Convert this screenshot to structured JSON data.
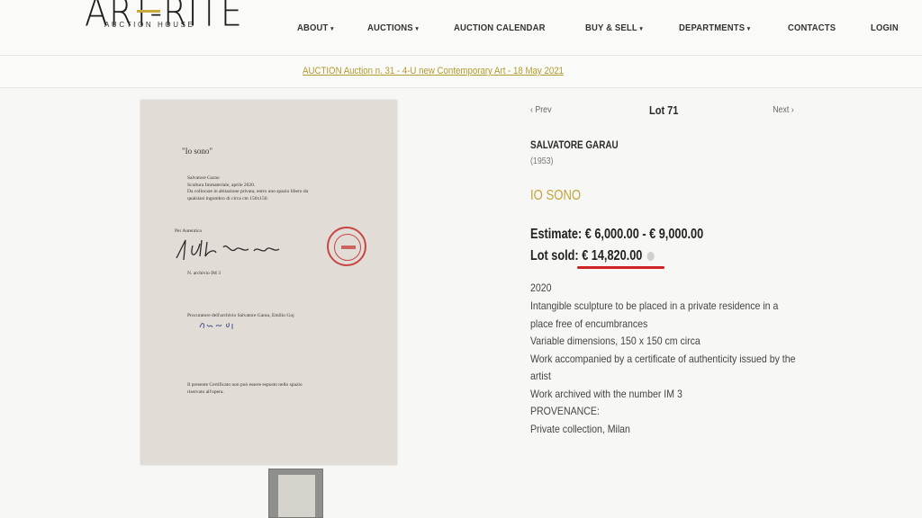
{
  "header": {
    "logo_main": "ART-RITE",
    "logo_sub": "AUCTION HOUSE",
    "nav": [
      {
        "label": "ABOUT",
        "dropdown": true
      },
      {
        "label": "AUCTIONS",
        "dropdown": true
      },
      {
        "label": "AUCTION CALENDAR",
        "dropdown": false
      },
      {
        "label": "BUY & SELL",
        "dropdown": true
      },
      {
        "label": "DEPARTMENTS",
        "dropdown": true
      },
      {
        "label": "CONTACTS",
        "dropdown": false
      },
      {
        "label": "LOGIN",
        "dropdown": false
      }
    ],
    "caret": "▾"
  },
  "auction_bar": {
    "link": "AUCTION Auction n. 31 - 4-U new Contemporary Art - 18 May 2021"
  },
  "certificate": {
    "title": "\"Io sono\"",
    "body": "Salvatore Garau\nScultura Immateriale, aprile 2020.\nDa collocare in abitazione privata, entro uno spazio libero da\nqualsiasi ingombro di circa cm 150x150.",
    "autentica": "Per Autentica",
    "archivio": "N. archivio IM 3",
    "procuratore": "Procuratore dell'archivio Salvatore Garau, Emilio Goj",
    "footer": "Il presente Certificato non può essere esposto nello spazio\nriservato all'opera."
  },
  "lot": {
    "prev": "‹ Prev",
    "number": "Lot 71",
    "next": "Next ›",
    "artist": "SALVATORE GARAU",
    "years": "(1953)",
    "title": "IO SONO",
    "estimate": "Estimate: € 6,000.00 - € 9,000.00",
    "sold_label": "Lot sold: ",
    "sold_value": "€ 14,820.00",
    "year": "2020",
    "description": [
      "Intangible sculpture to be placed in a private residence in a",
      "place free of encumbrances",
      "Variable dimensions, 150 x 150 cm circa",
      "Work accompanied by a certificate of authenticity issued by the",
      "artist",
      "Work archived with the number IM 3",
      "PROVENANCE:",
      "Private collection, Milan"
    ]
  },
  "colors": {
    "gold": "#c2a63d",
    "highlight": "#cf2323",
    "stamp": "#c94444"
  }
}
